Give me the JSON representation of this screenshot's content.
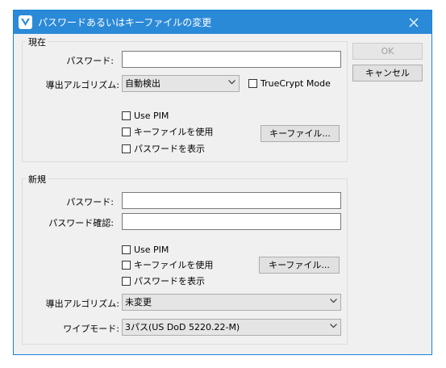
{
  "window": {
    "title": "パスワードあるいはキーファイルの変更",
    "icon": "veracrypt-logo-icon",
    "close_icon": "close-icon"
  },
  "buttons": {
    "ok": "OK",
    "cancel": "キャンセル"
  },
  "current": {
    "group_title": "現在",
    "password_label": "パスワード:",
    "password_value": "",
    "prf_label": "導出アルゴリズム:",
    "prf_value": "自動検出",
    "truecrypt_mode": "TrueCrypt Mode",
    "use_pim": "Use PIM",
    "use_keyfiles": "キーファイルを使用",
    "keyfiles_button": "キーファイル...",
    "display_password": "パスワードを表示"
  },
  "new": {
    "group_title": "新規",
    "password_label": "パスワード:",
    "password_value": "",
    "confirm_label": "パスワード確認:",
    "confirm_value": "",
    "use_pim": "Use PIM",
    "use_keyfiles": "キーファイルを使用",
    "keyfiles_button": "キーファイル...",
    "display_password": "パスワードを表示",
    "prf_label": "導出アルゴリズム:",
    "prf_value": "未変更",
    "wipe_label": "ワイプモード:",
    "wipe_value": "3パス(US DoD 5220.22-M)"
  },
  "colors": {
    "titlebar": "#2b8ad8",
    "window_border": "#1883d7",
    "dialog_bg": "#f0f0f0"
  }
}
